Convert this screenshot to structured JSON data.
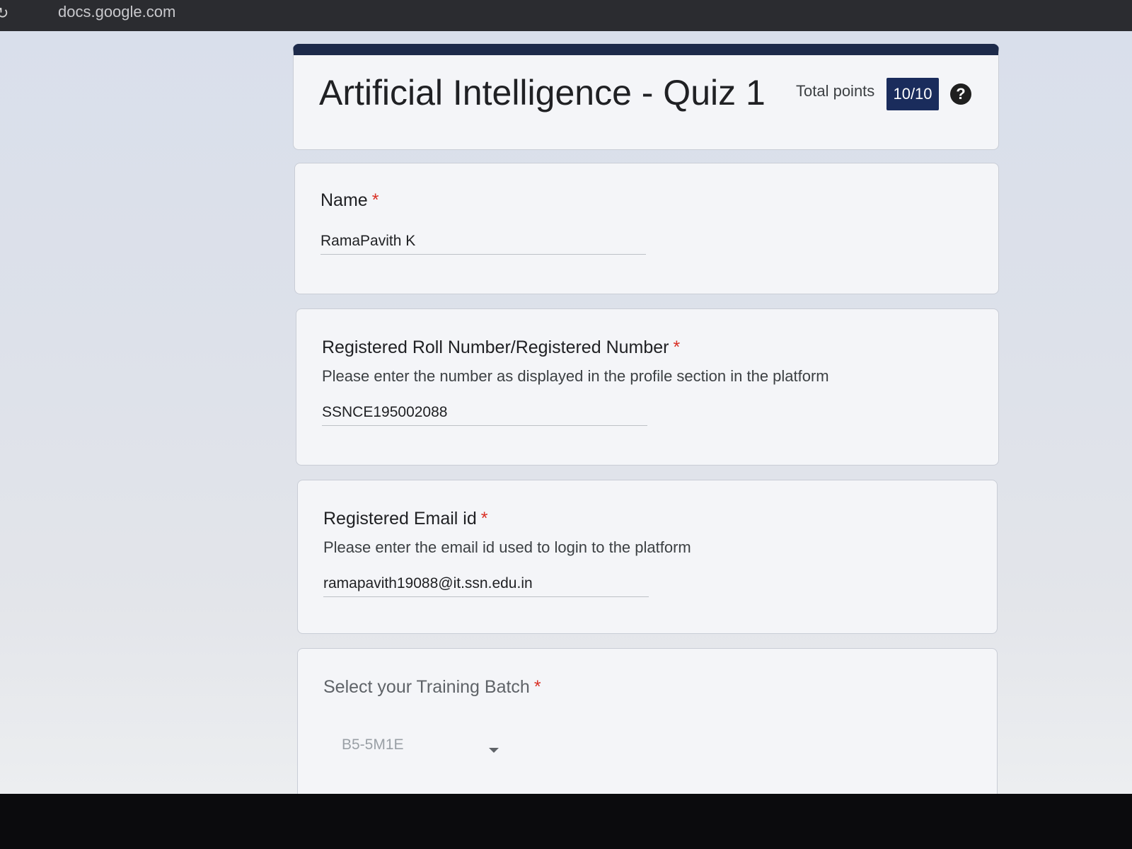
{
  "browser": {
    "reload_icon": "reload-icon",
    "domain": "docs.google.com"
  },
  "header": {
    "title": "Artificial Intelligence - Quiz 1",
    "total_points_label": "Total points",
    "total_points_value": "10/10",
    "help_icon": "?"
  },
  "questions": [
    {
      "label": "Name",
      "required_mark": "*",
      "answer": "RamaPavith K"
    },
    {
      "label": "Registered Roll Number/Registered Number",
      "required_mark": "*",
      "description": "Please enter the number as displayed in the profile section in the platform",
      "answer": "SSNCE195002088"
    },
    {
      "label": "Registered Email id",
      "required_mark": "*",
      "description": "Please enter the email id used to login to the platform",
      "answer": "ramapavith19088@it.ssn.edu.in"
    },
    {
      "label": "Select your Training Batch",
      "required_mark": "*",
      "selected": "B5-5M1E"
    }
  ],
  "colors": {
    "header_accent": "#1d2a4a",
    "points_badge": "#1a2c5c",
    "required_star": "#d93025"
  }
}
